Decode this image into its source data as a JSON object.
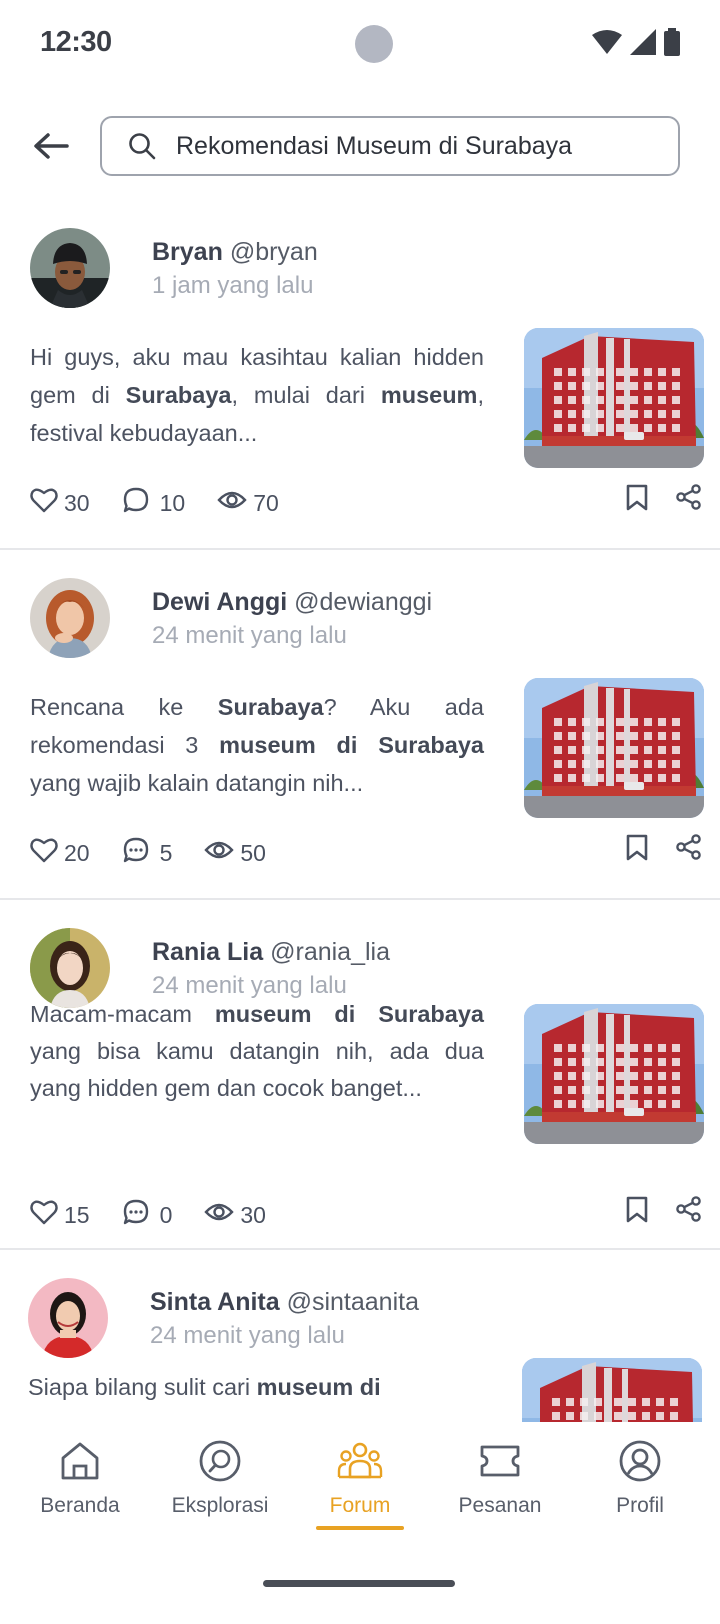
{
  "status": {
    "time": "12:30"
  },
  "search": {
    "query": "Rekomendasi Museum di Surabaya"
  },
  "posts": [
    {
      "name": "Bryan",
      "handle": "@bryan",
      "time": "1 jam yang lalu",
      "text": [
        {
          "t": "Hi guys, aku mau kasihtau kalian hidden gem di "
        },
        {
          "t": "Surabaya",
          "b": true
        },
        {
          "t": ", mulai dari "
        },
        {
          "t": "museum",
          "b": true
        },
        {
          "t": ", festival kebudayaan..."
        }
      ],
      "likes": "30",
      "comments": "10",
      "views": "70"
    },
    {
      "name": "Dewi Anggi",
      "handle": "@dewianggi",
      "time": "24 menit yang lalu",
      "text": [
        {
          "t": "Rencana ke "
        },
        {
          "t": "Surabaya",
          "b": true
        },
        {
          "t": "? Aku ada rekomendasi 3 "
        },
        {
          "t": "museum di Surabaya",
          "b": true
        },
        {
          "t": " yang wajib kalain datangin nih..."
        }
      ],
      "likes": "20",
      "comments": "5",
      "views": "50"
    },
    {
      "name": "Rania Lia",
      "handle": "@rania_lia",
      "time": "24 menit yang lalu",
      "text": [
        {
          "t": "Macam-macam "
        },
        {
          "t": "museum di Surabaya",
          "b": true
        },
        {
          "t": " yang bisa kamu datangin nih, ada dua yang hidden gem dan cocok banget..."
        }
      ],
      "likes": "15",
      "comments": "0",
      "views": "30"
    },
    {
      "name": "Sinta Anita",
      "handle": "@sintaanita",
      "time": "24 menit yang lalu",
      "text": [
        {
          "t": "Siapa bilang sulit cari "
        },
        {
          "t": "museum di",
          "b": true
        }
      ],
      "likes": "",
      "comments": "",
      "views": ""
    }
  ],
  "nav": {
    "items": [
      {
        "label": "Beranda",
        "icon": "home-icon"
      },
      {
        "label": "Eksplorasi",
        "icon": "explore-icon"
      },
      {
        "label": "Forum",
        "icon": "forum-icon",
        "active": true
      },
      {
        "label": "Pesanan",
        "icon": "ticket-icon"
      },
      {
        "label": "Profil",
        "icon": "profile-icon"
      }
    ]
  },
  "colors": {
    "accent": "#e8a223",
    "text": "#4a5160",
    "muted": "#a6abb5"
  }
}
